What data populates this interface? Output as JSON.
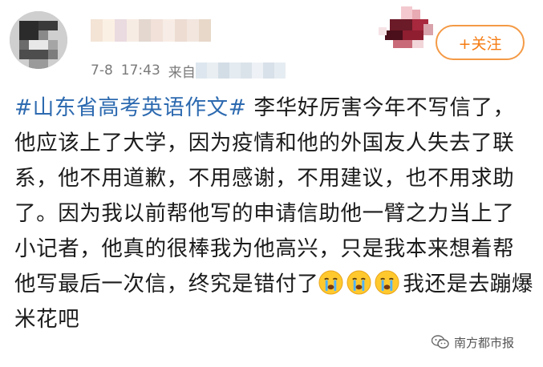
{
  "header": {
    "date": "7-8",
    "time": "17:43",
    "source_prefix": "来自",
    "follow_label": "+关注"
  },
  "post": {
    "hashtag": "#山东省高考英语作文#",
    "text_before_emoji": " 李华好厉害今年不写信了，他应该上了大学，因为疫情和他的外国友人失去了联系，他不用道歉，不用感谢，不用建议，也不用求助了。因为我以前帮他写的申请信助他一臂之力当上了小记者，他真的很棒我为他高兴，只是我本来想着帮他写最后一次信，终究是错付了",
    "emoji_count": 3,
    "emoji_icon": "crying-face-icon",
    "text_after_emoji": "我还是去蹦爆米花吧"
  },
  "watermark": {
    "label": "南方都市报",
    "icon": "wechat-icon"
  },
  "colors": {
    "hashtag": "#2d6ab0",
    "follow_border": "#f49a46",
    "follow_text": "#f57c13",
    "meta_text": "#7a7a7a"
  }
}
